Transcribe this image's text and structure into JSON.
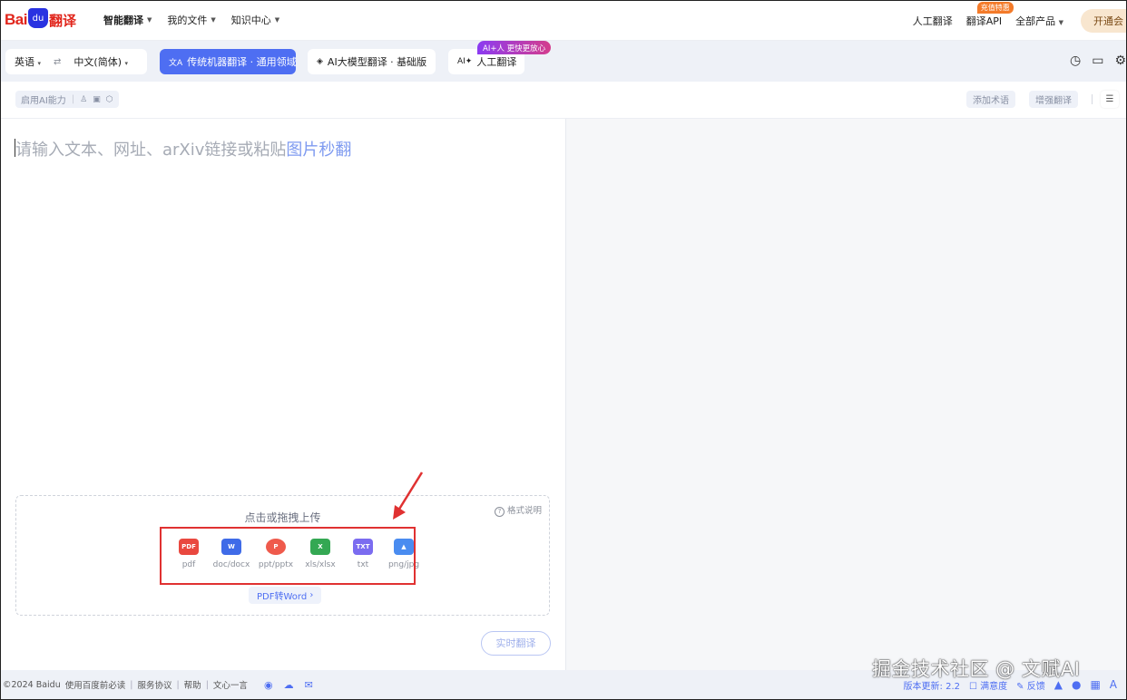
{
  "nav": {
    "logo_bai": "Bai",
    "logo_du": "du",
    "logo_fy": "翻译",
    "menu": [
      {
        "label": "智能翻译"
      },
      {
        "label": "我的文件"
      },
      {
        "label": "知识中心"
      }
    ],
    "human_translate": "人工翻译",
    "api_label": "翻译API",
    "api_badge": "充值特惠",
    "all_products": "全部产品",
    "open_button": "开通会"
  },
  "toolbar": {
    "source_lang": "英语",
    "target_lang": "中文(简体)",
    "mode_machine": "传统机器翻译 · 通用领域",
    "mode_llm": "AI大模型翻译 · 基础版",
    "mode_human": "人工翻译",
    "ai_badge": "AI+人 更快更放心"
  },
  "subbar": {
    "ai_capability": "启用AI能力",
    "add_term": "添加术语",
    "enhance": "增强翻译"
  },
  "input": {
    "placeholder_main": "请输入文本、网址、arXiv链接或粘贴",
    "placeholder_highlight": "图片秒翻"
  },
  "upload": {
    "title": "点击或拖拽上传",
    "help": "格式说明",
    "file_types": [
      {
        "label": "pdf",
        "color": "#e9483f"
      },
      {
        "label": "doc/docx",
        "color": "#3f6be8"
      },
      {
        "label": "ppt/pptx",
        "color": "#ef5a4c"
      },
      {
        "label": "xls/xlsx",
        "color": "#34a853"
      },
      {
        "label": "txt",
        "color": "#7b6cf0"
      },
      {
        "label": "png/jpg",
        "color": "#4a8cf0"
      }
    ],
    "pdf_to_word": "PDF转Word"
  },
  "realtime_button": "实时翻译",
  "footer": {
    "copyright": "©2024 Baidu",
    "links": [
      "使用百度前必读",
      "服务协议",
      "帮助",
      "文心一言"
    ],
    "version_label": "版本更新:",
    "version_value": "2.2",
    "satisfaction": "满意度",
    "feedback": "反馈"
  },
  "watermark": "掘金技术社区 @ 文赋AI",
  "colors": {
    "accent": "#4e6ef2",
    "highlight_box": "#e03131",
    "brand_red": "#e1251b"
  }
}
